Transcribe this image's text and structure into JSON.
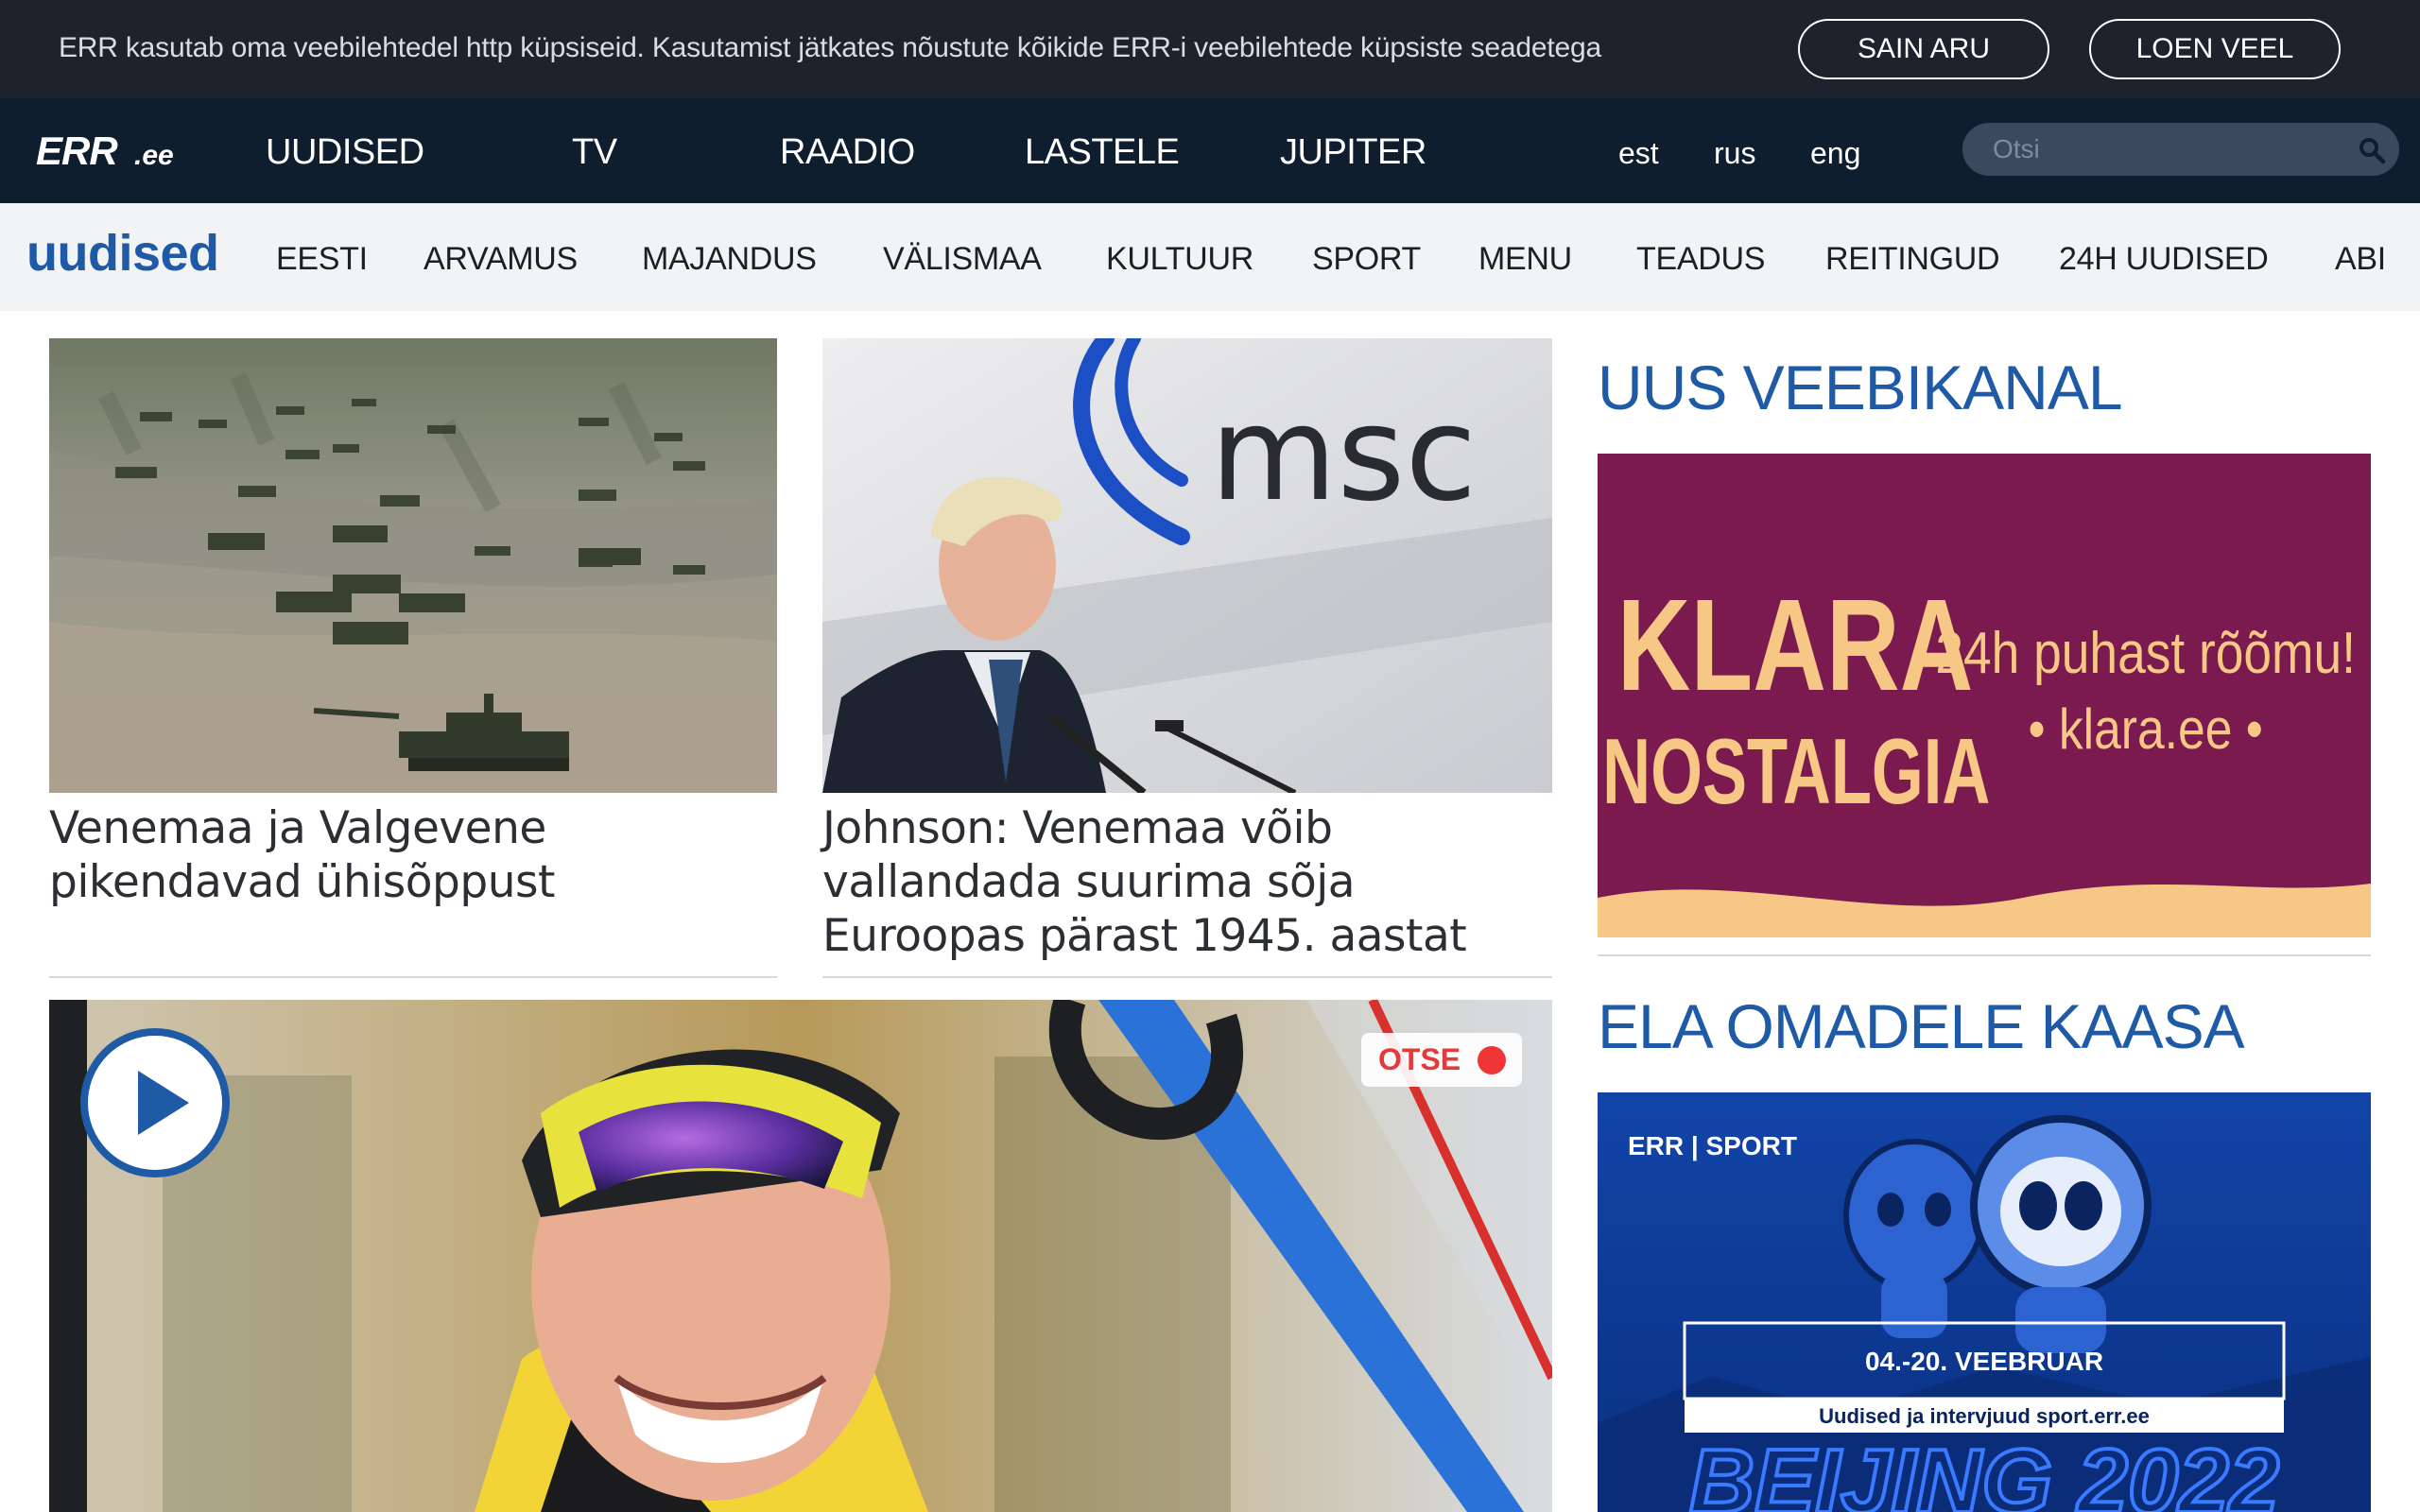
{
  "cookie_bar": {
    "message": "ERR kasutab oma veebilehtedel http küpsiseid. Kasutamist jätkates nõustute kõikide ERR-i veebilehtede küpsiste seadetega",
    "accept_label": "SAIN ARU",
    "more_label": "LOEN VEEL"
  },
  "main_nav": {
    "logo_main": "ERR",
    "logo_suffix": ".ee",
    "items": [
      "UUDISED",
      "TV",
      "RAADIO",
      "LASTELE",
      "JUPITER"
    ],
    "languages": [
      "est",
      "rus",
      "eng"
    ],
    "search_placeholder": "Otsi"
  },
  "sub_nav": {
    "brand": "uudised",
    "items": [
      "EESTI",
      "ARVAMUS",
      "MAJANDUS",
      "VÄLISMAA",
      "KULTUUR",
      "SPORT",
      "MENU",
      "TEADUS",
      "REITINGUD",
      "24H UUDISED",
      "ABI"
    ]
  },
  "articles": [
    {
      "headline": "Venemaa ja Valgevene pikendavad ühisõppust"
    },
    {
      "headline": "Johnson: Venemaa võib vallandada suurima sõja Euroopas pärast 1945. aastat",
      "image_text": "msc"
    },
    {
      "badge": "OTSE"
    }
  ],
  "sidebar": {
    "section1_title": "UUS VEEBIKANAL",
    "klara": {
      "line1": "KLARA",
      "line2": "NOSTALGIA",
      "slogan": "24h puhast rõõmu!",
      "site": "• klara.ee •"
    },
    "section2_title": "ELA OMADELE KAASA",
    "olympics": {
      "brand": "ERR | SPORT",
      "dates": "04.-20. VEEBRUAR",
      "subtitle": "Uudised ja intervjuud sport.err.ee",
      "big_text": "BEIJING 2022"
    }
  },
  "colors": {
    "cookie_bg": "#1c232d",
    "nav_bg": "#0e1e2f",
    "subnav_bg": "#f2f3f5",
    "accent_blue": "#1f5aa6",
    "klara_bg": "#7a1a4e",
    "klara_text": "#f7c785",
    "live_red": "#ee3434"
  }
}
